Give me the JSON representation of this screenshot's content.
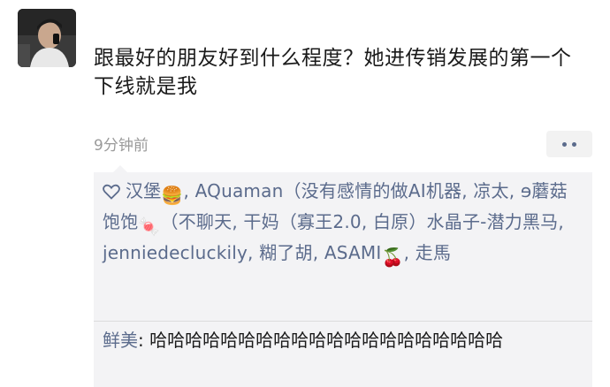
{
  "post": {
    "text": "跟最好的朋友好到什么程度？她进传销发展的第一个下线就是我",
    "time": "9分钟前"
  },
  "likes": {
    "heart_icon": "heart-outline-icon",
    "names_1": "汉堡",
    "emoji_burger": "🍔",
    "names_2": ", AQuaman（没有感情的做AI机器, 凉太, ɘ蘑菇饱饱",
    "emoji_candy": "🍬",
    "names_3": "（不聊天, 干妈（寡王2.0, 白原）水晶子-潜力黑马, jenniedecluckily, 糊了胡, ASAMI",
    "emoji_cherry": "🍒",
    "names_4": ", 走馬"
  },
  "comment": {
    "author": "鲜美",
    "separator": ": ",
    "text": "哈哈哈哈哈哈哈哈哈哈哈哈哈哈哈哈哈哈哈哈"
  },
  "colors": {
    "name_blue": "#5b6b8c",
    "box_bg": "#f3f3f5",
    "time_gray": "#9a9a9a"
  }
}
